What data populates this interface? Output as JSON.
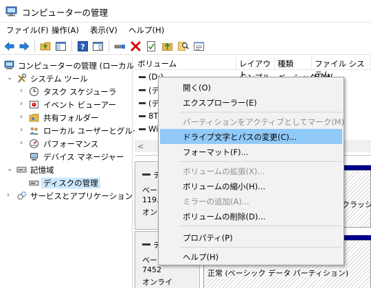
{
  "window": {
    "title": "コンピューターの管理",
    "app_icon": "computer-management-icon"
  },
  "menubar": [
    {
      "label": "ファイル(F)"
    },
    {
      "label": "操作(A)"
    },
    {
      "label": "表示(V)"
    },
    {
      "label": "ヘルプ(H)"
    }
  ],
  "toolbar": {
    "icons": [
      "back-arrow-icon",
      "forward-arrow-icon",
      "up-folder-icon",
      "show-hide-tree-icon",
      "help-icon",
      "action-pane-icon",
      "connect-icon",
      "delete-icon",
      "checkmark-icon",
      "up-arrow-folder-icon",
      "search-icon",
      "properties-icon"
    ],
    "colors": {
      "delete": "#d40000",
      "folder": "#e8b84a",
      "help": "#2b5fb8"
    }
  },
  "tree": {
    "items": [
      {
        "label": "コンピューターの管理 (ローカル)",
        "icon": "computer-management-icon",
        "chevron": ""
      },
      {
        "label": "システム ツール",
        "icon": "tools-icon",
        "chevron": "⌄"
      },
      {
        "label": "タスク スケジューラ",
        "icon": "clock-icon",
        "chevron": "›"
      },
      {
        "label": "イベント ビューアー",
        "icon": "event-viewer-icon",
        "chevron": "›"
      },
      {
        "label": "共有フォルダー",
        "icon": "shared-folder-icon",
        "chevron": "›"
      },
      {
        "label": "ローカル ユーザーとグループ",
        "icon": "users-icon",
        "chevron": "›"
      },
      {
        "label": "パフォーマンス",
        "icon": "performance-icon",
        "chevron": "›"
      },
      {
        "label": "デバイス マネージャー",
        "icon": "device-manager-icon",
        "chevron": ""
      },
      {
        "label": "記憶域",
        "icon": "storage-icon",
        "chevron": "⌄"
      },
      {
        "label": "ディスクの管理",
        "icon": "disk-management-icon",
        "chevron": ""
      },
      {
        "label": "サービスとアプリケーション",
        "icon": "services-icon",
        "chevron": "›"
      }
    ],
    "selected_label": "ディスクの管理"
  },
  "volumes": {
    "headers": [
      "ボリューム",
      "レイアウト",
      "種類",
      "ファイル システム"
    ],
    "rows": [
      {
        "name": "(D:)",
        "layout": "シンプル",
        "type": "ベーシック",
        "fs": "RAW"
      },
      {
        "name": "(ディ",
        "layout": "",
        "type": "",
        "fs": ""
      },
      {
        "name": "(ディ",
        "layout": "",
        "type": "",
        "fs": ""
      },
      {
        "name": "8TI",
        "layout": "",
        "type": "",
        "fs": ""
      },
      {
        "name": "Wi",
        "layout": "",
        "type": "",
        "fs": ""
      }
    ],
    "scroll_left": "<"
  },
  "diskmap": {
    "disks": [
      {
        "line1": "デ",
        "line2": "ベーシ",
        "line3": "119.2",
        "line4": "オンラ"
      },
      {
        "line1": "デ",
        "line2": "ベーシ",
        "line3": "7452",
        "line4": "オンライ"
      }
    ],
    "partition_text_1": "クラッシ",
    "partition_text_2": "正常 (ベーシック データ パーティション)",
    "accent": "#00008b"
  },
  "context_menu": {
    "items": [
      {
        "label": "開く(O)",
        "enabled": true
      },
      {
        "label": "エクスプローラー(E)",
        "enabled": true
      },
      {
        "label": "パーティションをアクティブとしてマーク(M)",
        "enabled": false
      },
      {
        "label": "ドライブ文字とパスの変更(C)...",
        "enabled": true,
        "highlighted": true
      },
      {
        "label": "フォーマット(F)...",
        "enabled": true
      },
      {
        "label": "ボリュームの拡張(X)...",
        "enabled": false
      },
      {
        "label": "ボリュームの縮小(H)...",
        "enabled": true
      },
      {
        "label": "ミラーの追加(A)...",
        "enabled": false
      },
      {
        "label": "ボリュームの削除(D)...",
        "enabled": true
      },
      {
        "label": "プロパティ(P)",
        "enabled": true
      },
      {
        "label": "ヘルプ(H)",
        "enabled": true
      }
    ],
    "highlight_color": "#91c9f7"
  }
}
